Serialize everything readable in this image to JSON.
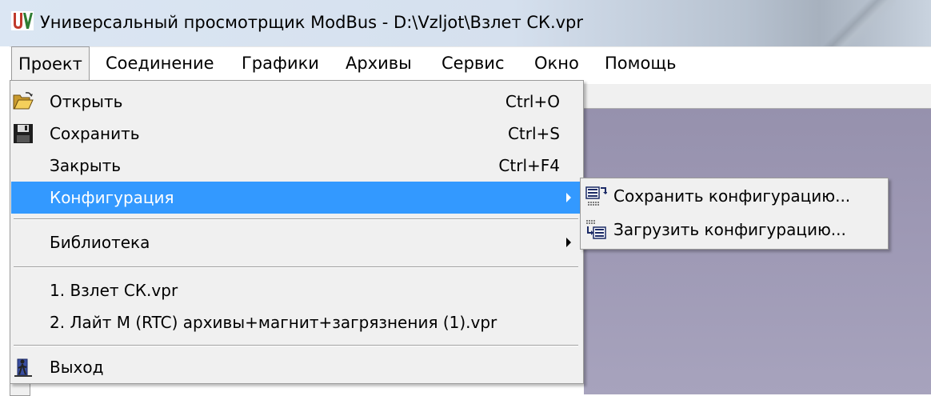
{
  "window": {
    "title": "Универсальный просмотрщик ModBus - D:\\Vzljot\\Взлет СК.vpr",
    "icon": "app-logo-icon"
  },
  "menubar": {
    "items": [
      {
        "label": "Проект",
        "open": true
      },
      {
        "label": "Соединение"
      },
      {
        "label": "Графики"
      },
      {
        "label": "Архивы"
      },
      {
        "label": "Сервис"
      },
      {
        "label": "Окно"
      },
      {
        "label": "Помощь"
      }
    ]
  },
  "project_menu": {
    "open": {
      "label": "Открыть",
      "shortcut": "Ctrl+O",
      "icon": "folder-open-icon"
    },
    "save": {
      "label": "Сохранить",
      "shortcut": "Ctrl+S",
      "icon": "floppy-disk-icon"
    },
    "close": {
      "label": "Закрыть",
      "shortcut": "Ctrl+F4"
    },
    "configuration": {
      "label": "Конфигурация",
      "highlighted": true,
      "has_submenu": true
    },
    "library": {
      "label": "Библиотека",
      "has_submenu": true
    },
    "recent": [
      {
        "label": "1. Взлет СК.vpr"
      },
      {
        "label": "2. Лайт М (RTC) архивы+магнит+загрязнения (1).vpr"
      }
    ],
    "exit": {
      "label": "Выход",
      "icon": "exit-door-icon"
    }
  },
  "configuration_submenu": {
    "items": [
      {
        "label": "Сохранить конфигурацию...",
        "icon": "save-config-icon"
      },
      {
        "label": "Загрузить конфигурацию...",
        "icon": "load-config-icon"
      }
    ]
  },
  "colors": {
    "highlight": "#3399ff",
    "menu_background": "#f0f0f0",
    "workspace": "#9d98b4"
  }
}
